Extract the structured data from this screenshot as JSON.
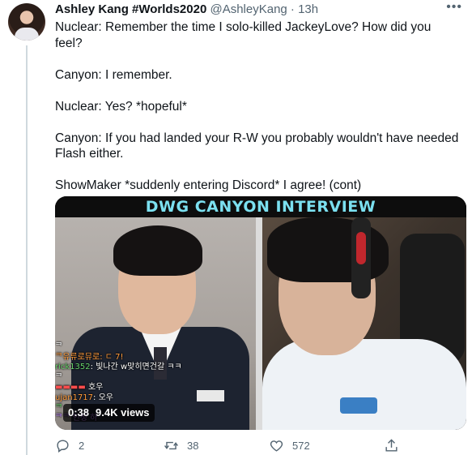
{
  "tweet": {
    "author_name": "Ashley Kang #Worlds2020",
    "handle": "@AshleyKang",
    "separator": "·",
    "time": "13h",
    "more_icon": "more-dots-icon",
    "lines": [
      "Nuclear: Remember the time I solo-killed JackeyLove? How did you feel?",
      "",
      "Canyon: I remember.",
      "",
      "Nuclear: Yes? *hopeful*",
      "",
      "Canyon: If you had landed your R-W you probably wouldn't have needed Flash either.",
      "",
      "ShowMaker *suddenly entering Discord* I agree! (cont)"
    ]
  },
  "media": {
    "banner": "DWG CANYON INTERVIEW",
    "banner_color": "#7be0f0",
    "duration": "0:38",
    "views": "9.4K views",
    "chat": [
      {
        "nick": "",
        "msg": "ᄏ"
      },
      {
        "nick": "",
        "msg": "ᄏ유류로뮤로: ㄷ 7!"
      },
      {
        "nick": "rick1352",
        "msg": "빛나간 w맞히면건갈 ㅋㅋ"
      },
      {
        "nick": "",
        "msg": "ᄏ"
      },
      {
        "nick": "",
        "msg": "호우"
      },
      {
        "nick": "ujan1717",
        "msg": "오우"
      },
      {
        "nick": "",
        "msg": "ᄏ"
      },
      {
        "nick": "",
        "msg": "ᄏᄏ 인정 하"
      }
    ]
  },
  "actions": {
    "reply_count": "2",
    "retweet_count": "38",
    "like_count": "572",
    "reply_icon": "reply-icon",
    "retweet_icon": "retweet-icon",
    "like_icon": "heart-icon",
    "share_icon": "share-icon"
  }
}
